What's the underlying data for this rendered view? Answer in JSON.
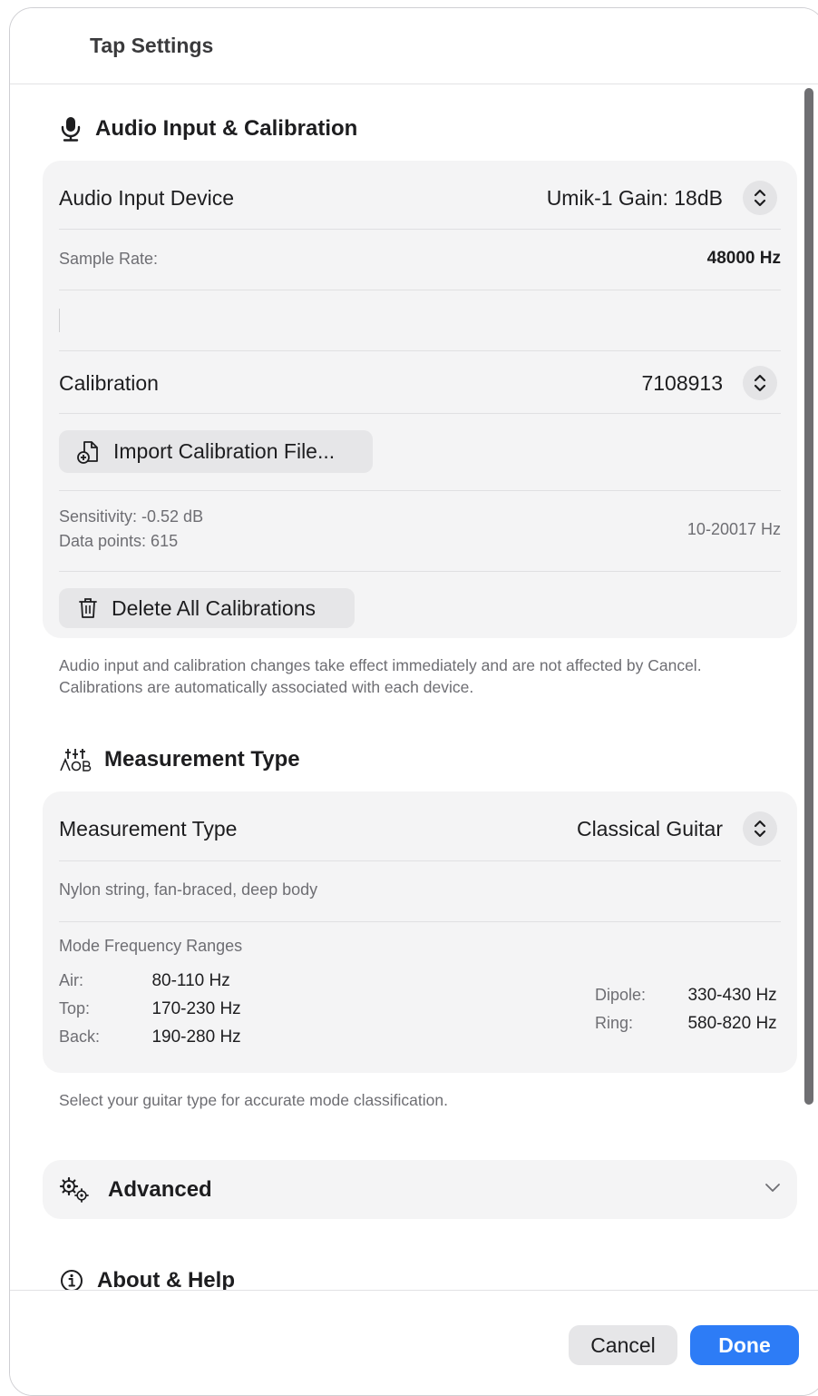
{
  "window": {
    "title": "Tap Settings"
  },
  "audio_section": {
    "icon": "microphone-icon",
    "heading": "Audio Input & Calibration",
    "device_label": "Audio Input Device",
    "device_value": "Umik-1  Gain: 18dB",
    "sample_rate_label": "Sample Rate:",
    "sample_rate_value": "48000 Hz",
    "calibration_label": "Calibration",
    "calibration_value": "7108913",
    "import_button": "Import Calibration File...",
    "sensitivity": "Sensitivity: -0.52 dB",
    "data_points": "Data points: 615",
    "freq_range": "10-20017 Hz",
    "delete_button": "Delete All Calibrations",
    "footnote": "Audio input and calibration changes take effect immediately and are not affected by Cancel. Calibrations are automatically associated with each device."
  },
  "measurement_section": {
    "icon": "tuning-fork-icon",
    "heading": "Measurement Type",
    "type_label": "Measurement Type",
    "type_value": "Classical Guitar",
    "description": "Nylon string, fan-braced, deep body",
    "ranges_title": "Mode Frequency Ranges",
    "ranges_left": [
      {
        "name": "Air:",
        "value": "80-110 Hz"
      },
      {
        "name": "Top:",
        "value": "170-230 Hz"
      },
      {
        "name": "Back:",
        "value": "190-280 Hz"
      }
    ],
    "ranges_right": [
      {
        "name": "Dipole:",
        "value": "330-430 Hz"
      },
      {
        "name": "Ring:",
        "value": "580-820 Hz"
      }
    ],
    "footnote": "Select your guitar type for accurate mode classification."
  },
  "advanced_section": {
    "icon": "gears-icon",
    "heading": "Advanced"
  },
  "about_section": {
    "icon": "info-icon",
    "heading": "About & Help"
  },
  "footer": {
    "cancel": "Cancel",
    "done": "Done"
  },
  "colors": {
    "accent": "#2d7cf6",
    "card_bg": "#f4f4f5"
  }
}
